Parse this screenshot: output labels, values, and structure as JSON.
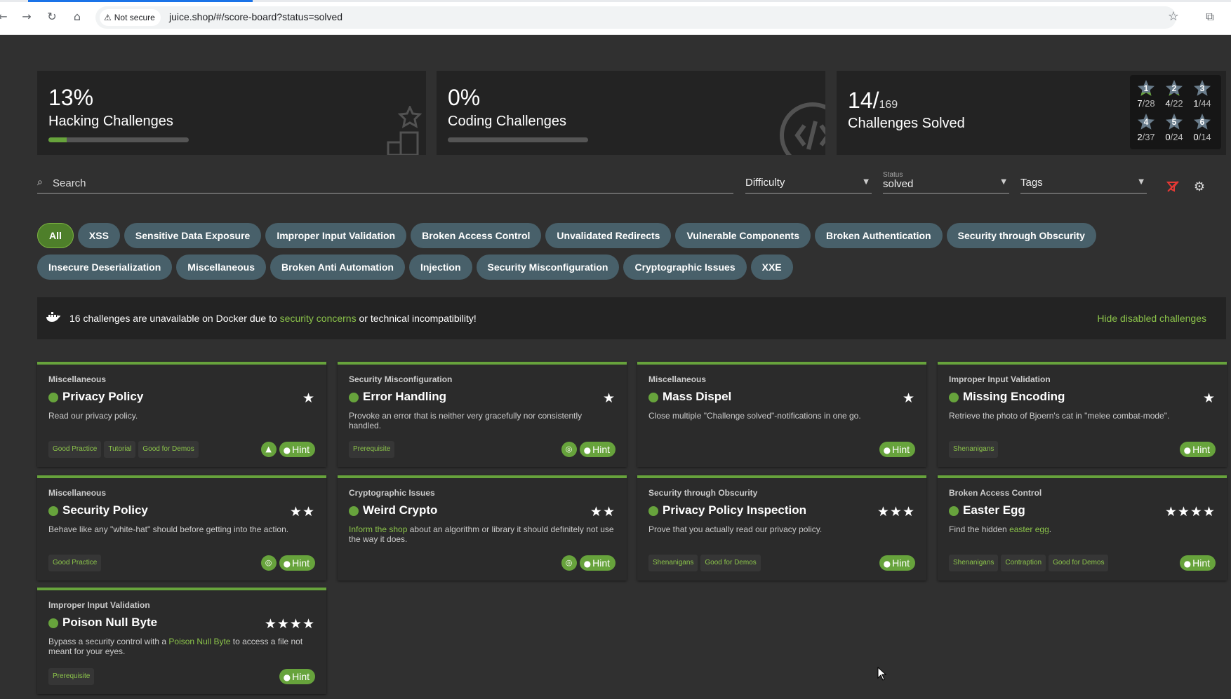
{
  "browser": {
    "security_label": "Not secure",
    "url": "juice.shop/#/score-board?status=solved"
  },
  "stats": {
    "hacking": {
      "percent": "13%",
      "label": "Hacking Challenges",
      "progress": 0.13
    },
    "coding": {
      "percent": "0%",
      "label": "Coding Challenges",
      "progress": 0.0
    },
    "solved": {
      "count": "14/",
      "total": "169",
      "label": "Challenges Solved"
    },
    "difficulty_breakdown": [
      {
        "level": "1",
        "solved": "7",
        "total": "/28"
      },
      {
        "level": "2",
        "solved": "4",
        "total": "/22"
      },
      {
        "level": "3",
        "solved": "1",
        "total": "/44"
      },
      {
        "level": "4",
        "solved": "2",
        "total": "/37"
      },
      {
        "level": "5",
        "solved": "0",
        "total": "/24"
      },
      {
        "level": "6",
        "solved": "0",
        "total": "/14"
      }
    ]
  },
  "filters": {
    "search_placeholder": "Search",
    "difficulty_label": "Difficulty",
    "status_label": "Status",
    "status_value": "solved",
    "tags_label": "Tags"
  },
  "categories": [
    "All",
    "XSS",
    "Sensitive Data Exposure",
    "Improper Input Validation",
    "Broken Access Control",
    "Unvalidated Redirects",
    "Vulnerable Components",
    "Broken Authentication",
    "Security through Obscurity",
    "Insecure Deserialization",
    "Miscellaneous",
    "Broken Anti Automation",
    "Injection",
    "Security Misconfiguration",
    "Cryptographic Issues",
    "XXE"
  ],
  "notice": {
    "text_before": "16 challenges are unavailable on Docker due to ",
    "link": "security concerns",
    "text_after": " or technical incompatibility!",
    "hide_label": "Hide disabled challenges"
  },
  "hint_label": "Hint",
  "colors": {
    "accent": "#67a33c",
    "link": "#8bc34a",
    "chip": "#48606a",
    "card": "#2b2b2b"
  },
  "cards": [
    {
      "category": "Miscellaneous",
      "name": "Privacy Policy",
      "stars": "★",
      "desc": "Read our privacy policy.",
      "tags": [
        "Good Practice",
        "Tutorial",
        "Good for Demos"
      ],
      "icon": "graduation-cap-icon"
    },
    {
      "category": "Security Misconfiguration",
      "name": "Error Handling",
      "stars": "★",
      "desc": "Provoke an error that is neither very gracefully nor consistently handled.",
      "tags": [
        "Prerequisite"
      ],
      "icon": "coding-challenge-icon"
    },
    {
      "category": "Miscellaneous",
      "name": "Mass Dispel",
      "stars": "★",
      "desc": "Close multiple \"Challenge solved\"-notifications in one go.",
      "tags": [],
      "icon": ""
    },
    {
      "category": "Improper Input Validation",
      "name": "Missing Encoding",
      "stars": "★",
      "desc": "Retrieve the photo of Bjoern's cat in \"melee combat-mode\".",
      "tags": [
        "Shenanigans"
      ],
      "icon": ""
    },
    {
      "category": "Miscellaneous",
      "name": "Security Policy",
      "stars": "★★",
      "desc": "Behave like any \"white-hat\" should before getting into the action.",
      "tags": [
        "Good Practice"
      ],
      "icon": "coding-challenge-icon"
    },
    {
      "category": "Cryptographic Issues",
      "name": "Weird Crypto",
      "stars": "★★",
      "desc_hl": "Inform the shop",
      "desc": " about an algorithm or library it should definitely not use the way it does.",
      "tags": [],
      "icon": "coding-challenge-icon"
    },
    {
      "category": "Security through Obscurity",
      "name": "Privacy Policy Inspection",
      "stars": "★★★",
      "desc": "Prove that you actually read our privacy policy.",
      "tags": [
        "Shenanigans",
        "Good for Demos"
      ],
      "icon": ""
    },
    {
      "category": "Broken Access Control",
      "name": "Easter Egg",
      "stars": "★★★★",
      "desc": "Find the hidden ",
      "desc_hl_end": "easter egg",
      "desc_end": ".",
      "tags": [
        "Shenanigans",
        "Contraption",
        "Good for Demos"
      ],
      "icon": ""
    },
    {
      "category": "Improper Input Validation",
      "name": "Poison Null Byte",
      "stars": "★★★★",
      "desc": "Bypass a security control with a ",
      "desc_hl_end": "Poison Null Byte",
      "desc_end": " to access a file not meant for your eyes.",
      "tags": [
        "Prerequisite"
      ],
      "icon": ""
    }
  ]
}
